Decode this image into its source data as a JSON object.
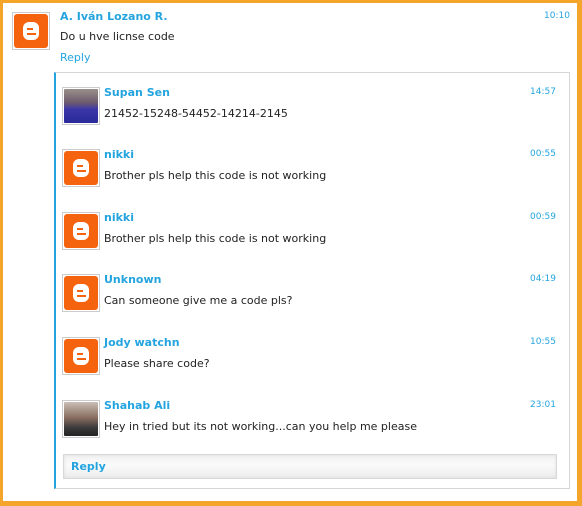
{
  "top_comment": {
    "author": "A. Iván Lozano R.",
    "time": "10:10",
    "text": "Do u hve licnse code",
    "avatar": "blogger-icon",
    "reply_label": "Reply"
  },
  "replies": [
    {
      "author": "Supan Sen",
      "time": "14:57",
      "text": "21452-15248-54452-14214-2145",
      "avatar": "user-photo"
    },
    {
      "author": "nikki",
      "time": "00:55",
      "text": "Brother pls help this code is not working",
      "avatar": "blogger-icon"
    },
    {
      "author": "nikki",
      "time": "00:59",
      "text": "Brother pls help this code is not working",
      "avatar": "blogger-icon"
    },
    {
      "author": "Unknown",
      "time": "04:19",
      "text": "Can someone give me a code pls?",
      "avatar": "blogger-icon"
    },
    {
      "author": "Jody watchn",
      "time": "10:55",
      "text": "Please share code?",
      "avatar": "blogger-icon"
    },
    {
      "author": "Shahab Ali",
      "time": "23:01",
      "text": "Hey in tried but its not working...can you help me please",
      "avatar": "user-photo"
    }
  ],
  "thread_reply_label": "Reply",
  "colors": {
    "accent": "#24a4df",
    "frame": "#f5a52a",
    "blogger": "#f5630e"
  }
}
